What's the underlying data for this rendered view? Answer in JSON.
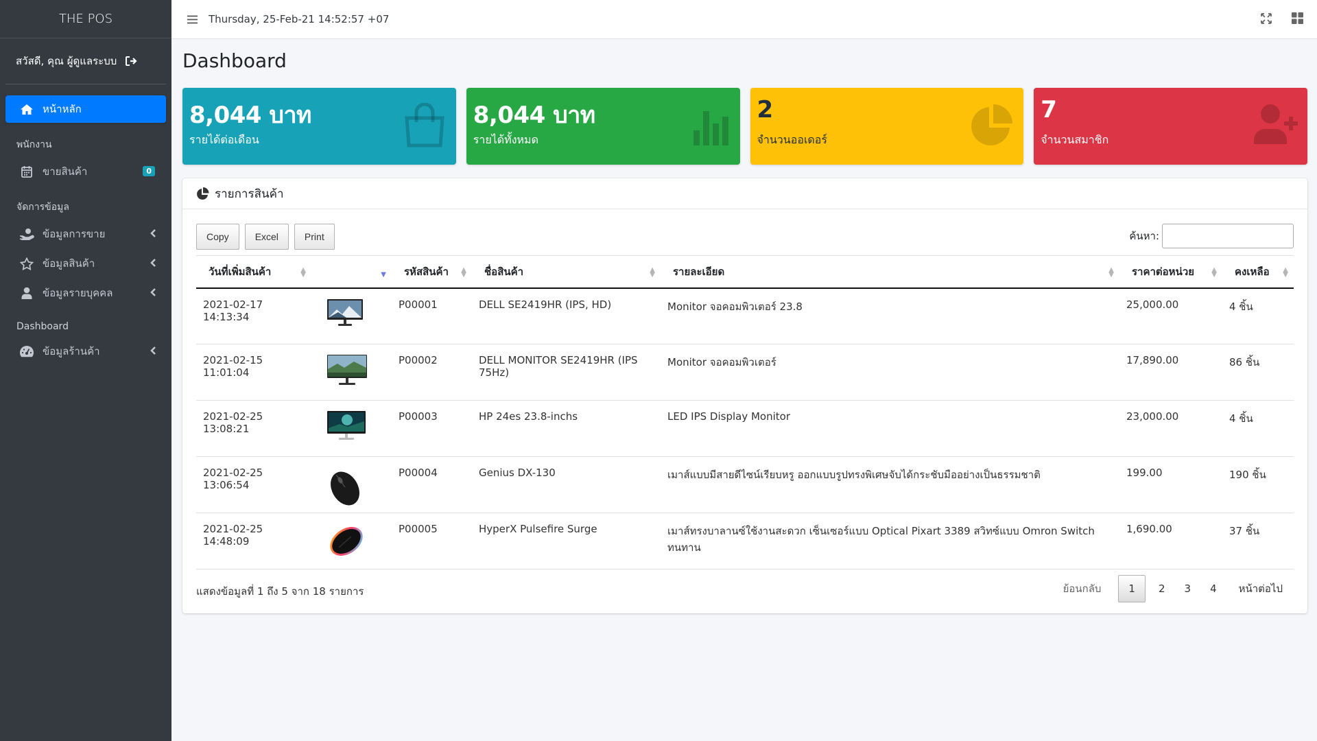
{
  "brand": "THE POS",
  "user": {
    "greeting": "สวัสดี, คุณ ผู้ดูแลระบบ"
  },
  "topbar": {
    "datetime": "Thursday, 25-Feb-21 14:52:57 +07"
  },
  "sidebar": {
    "home": "หน้าหลัก",
    "section_staff": "พนักงาน",
    "sell": "ขายสินค้า",
    "sell_badge": "0",
    "section_manage": "จัดการข้อมูล",
    "sales_data": "ข้อมูลการขาย",
    "product_data": "ข้อมูลสินค้า",
    "person_data": "ข้อมูลรายบุคคล",
    "section_dashboard": "Dashboard",
    "shop_data": "ข้อมูลร้านค้า"
  },
  "page": {
    "title": "Dashboard"
  },
  "stats": [
    {
      "value": "8,044 บาท",
      "label": "รายได้ต่อเดือน",
      "icon": "shopping-bag-icon"
    },
    {
      "value": "8,044 บาท",
      "label": "รายได้ทั้งหมด",
      "icon": "bar-chart-icon"
    },
    {
      "value": "2",
      "label": "จำนวนออเดอร์",
      "icon": "pie-chart-icon"
    },
    {
      "value": "7",
      "label": "จำนวนสมาชิก",
      "icon": "user-plus-icon"
    }
  ],
  "products": {
    "header": "รายการสินค้า",
    "buttons": {
      "copy": "Copy",
      "excel": "Excel",
      "print": "Print"
    },
    "search_label": "ค้นหา:",
    "columns": [
      "วันที่เพิ่มสินค้า",
      "",
      "รหัสสินค้า",
      "ชื่อสินค้า",
      "รายละเอียด",
      "ราคาต่อหน่วย",
      "คงเหลือ"
    ],
    "rows": [
      {
        "date": "2021-02-17 14:13:34",
        "image": "monitor",
        "code": "P00001",
        "name": "DELL SE2419HR (IPS, HD)",
        "detail": "Monitor จอคอมพิวเตอร์ 23.8",
        "price": "25,000.00",
        "stock": "4 ชิ้น"
      },
      {
        "date": "2021-02-15 11:01:04",
        "image": "monitor",
        "code": "P00002",
        "name": "DELL MONITOR SE2419HR (IPS 75Hz)",
        "detail": "Monitor จอคอมพิวเตอร์",
        "price": "17,890.00",
        "stock": "86 ชิ้น"
      },
      {
        "date": "2021-02-25 13:08:21",
        "image": "monitor",
        "code": "P00003",
        "name": "HP 24es 23.8-inchs",
        "detail": "LED IPS Display Monitor",
        "price": "23,000.00",
        "stock": "4 ชิ้น"
      },
      {
        "date": "2021-02-25 13:06:54",
        "image": "mouse",
        "code": "P00004",
        "name": "Genius DX-130",
        "detail": "เมาส์แบบมีสายดีไซน์เรียบหรู ออกแบบรูปทรงพิเศษจับได้กระชับมืออย่างเป็นธรรมชาติ",
        "price": "199.00",
        "stock": "190 ชิ้น"
      },
      {
        "date": "2021-02-25 14:48:09",
        "image": "mouse-rgb",
        "code": "P00005",
        "name": "HyperX Pulsefire Surge",
        "detail": "เมาส์ทรงบาลานซ์ใช้งานสะดวก เซ็นเซอร์แบบ Optical Pixart 3389 สวิทซ์แบบ Omron Switch ทนทาน",
        "price": "1,690.00",
        "stock": "37 ชิ้น"
      }
    ],
    "info": "แสดงข้อมูลที่ 1 ถึง 5 จาก 18 รายการ",
    "pagination": {
      "prev": "ย้อนกลับ",
      "pages": [
        "1",
        "2",
        "3",
        "4"
      ],
      "current": "1",
      "next": "หน้าต่อไป"
    }
  },
  "colors": {
    "info": "#17a2b8",
    "success": "#28a745",
    "warning": "#ffc107",
    "danger": "#dc3545",
    "primary": "#007bff",
    "sidebar": "#343a40"
  }
}
